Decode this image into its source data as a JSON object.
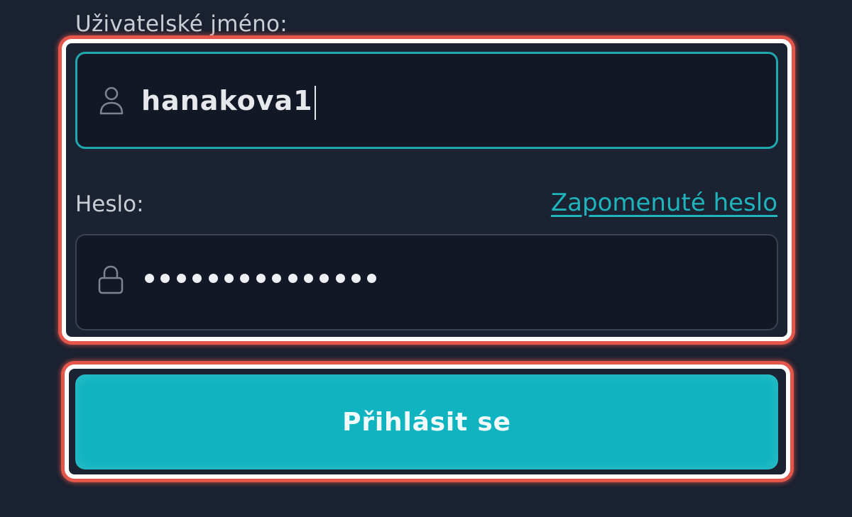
{
  "form": {
    "username_label": "Uživatelské jméno:",
    "username_value": "hanakova1",
    "password_label": "Heslo:",
    "forgot_password_link": "Zapomenuté heslo",
    "password_masked_length": 15,
    "login_button_label": "Přihlásit se"
  },
  "icons": {
    "username_field": "user-icon",
    "password_field": "lock-icon"
  },
  "colors": {
    "background": "#1a2130",
    "accent": "#10b3c0",
    "link": "#1fb4bc",
    "focused_border": "#1fa8ae",
    "highlight": "#e3564a"
  }
}
